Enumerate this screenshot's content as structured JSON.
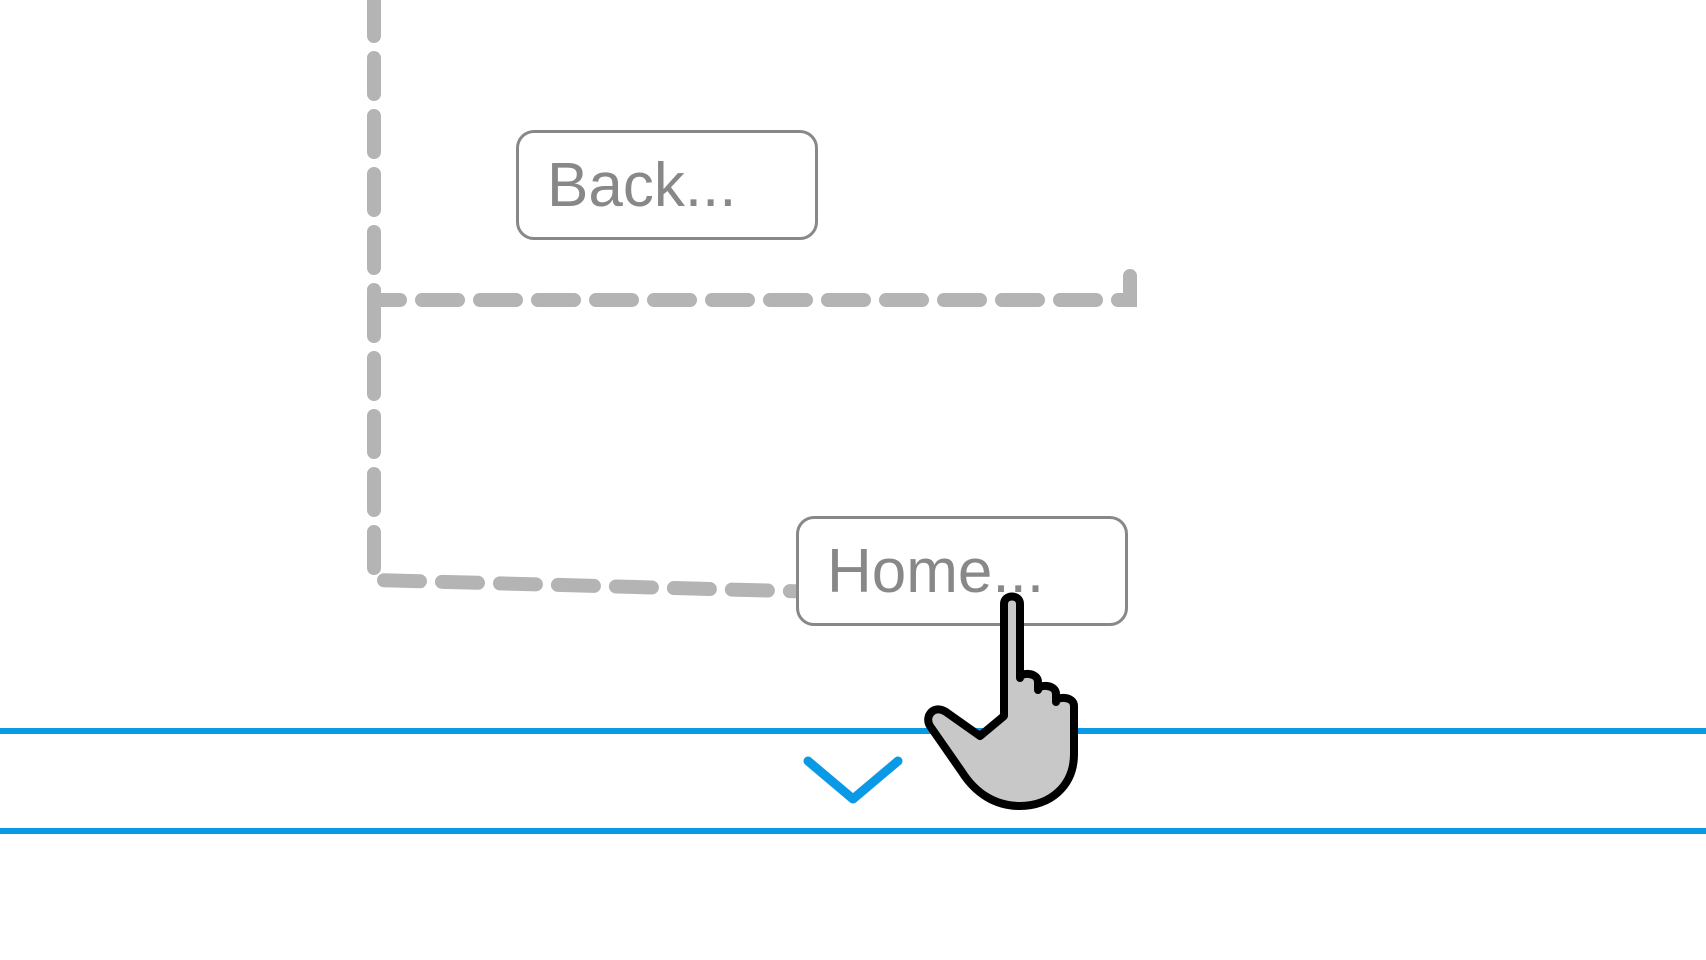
{
  "buttons": {
    "back_label": "Back...",
    "home_label": "Home..."
  },
  "colors": {
    "accent": "#0a99e5",
    "button_border": "#888888",
    "dashed": "#b4b4b4"
  }
}
